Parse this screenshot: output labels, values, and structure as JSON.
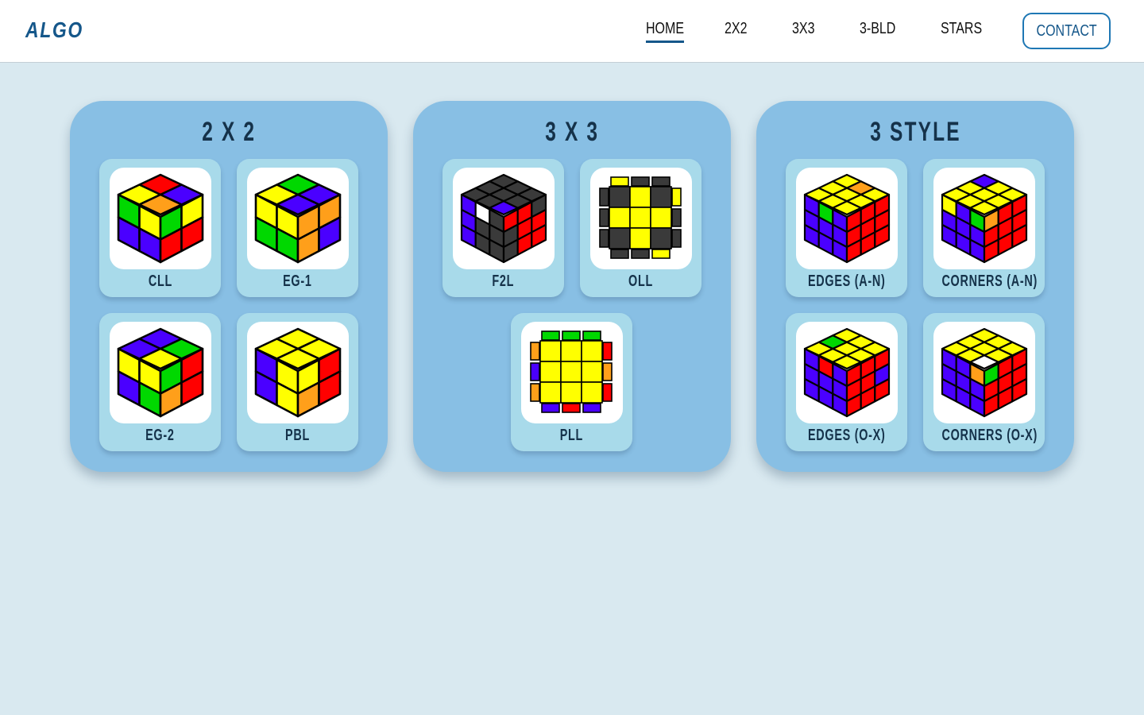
{
  "header": {
    "logo": "ALGO",
    "nav": [
      {
        "label": "HOME",
        "active": true
      },
      {
        "label": "2X2",
        "active": false
      },
      {
        "label": "3X3",
        "active": false
      },
      {
        "label": "3-BLD",
        "active": false
      },
      {
        "label": "STARS",
        "active": false
      }
    ],
    "contact_label": "CONTACT"
  },
  "colors": {
    "background": "#d9e9f0",
    "panel": "#88bfe4",
    "card": "#a8daea",
    "accent": "#15578a"
  },
  "sections": [
    {
      "title": "2 X 2",
      "cards": [
        {
          "label": "CLL",
          "icon": "cube-2x2-cll-icon"
        },
        {
          "label": "EG-1",
          "icon": "cube-2x2-eg1-icon"
        },
        {
          "label": "EG-2",
          "icon": "cube-2x2-eg2-icon"
        },
        {
          "label": "PBL",
          "icon": "cube-2x2-pbl-icon"
        }
      ]
    },
    {
      "title": "3 X 3",
      "cards": [
        {
          "label": "F2L",
          "icon": "cube-3x3-f2l-icon"
        },
        {
          "label": "OLL",
          "icon": "cube-3x3-oll-icon"
        },
        {
          "label": "PLL",
          "icon": "cube-3x3-pll-icon"
        }
      ]
    },
    {
      "title": "3 STYLE",
      "cards": [
        {
          "label": "EDGES (A-N)",
          "icon": "cube-3style-edges-an-icon"
        },
        {
          "label": "CORNERS (A-N)",
          "icon": "cube-3style-corners-an-icon"
        },
        {
          "label": "EDGES (O-X)",
          "icon": "cube-3style-edges-ox-icon"
        },
        {
          "label": "CORNERS (O-X)",
          "icon": "cube-3style-corners-ox-icon"
        }
      ]
    }
  ]
}
